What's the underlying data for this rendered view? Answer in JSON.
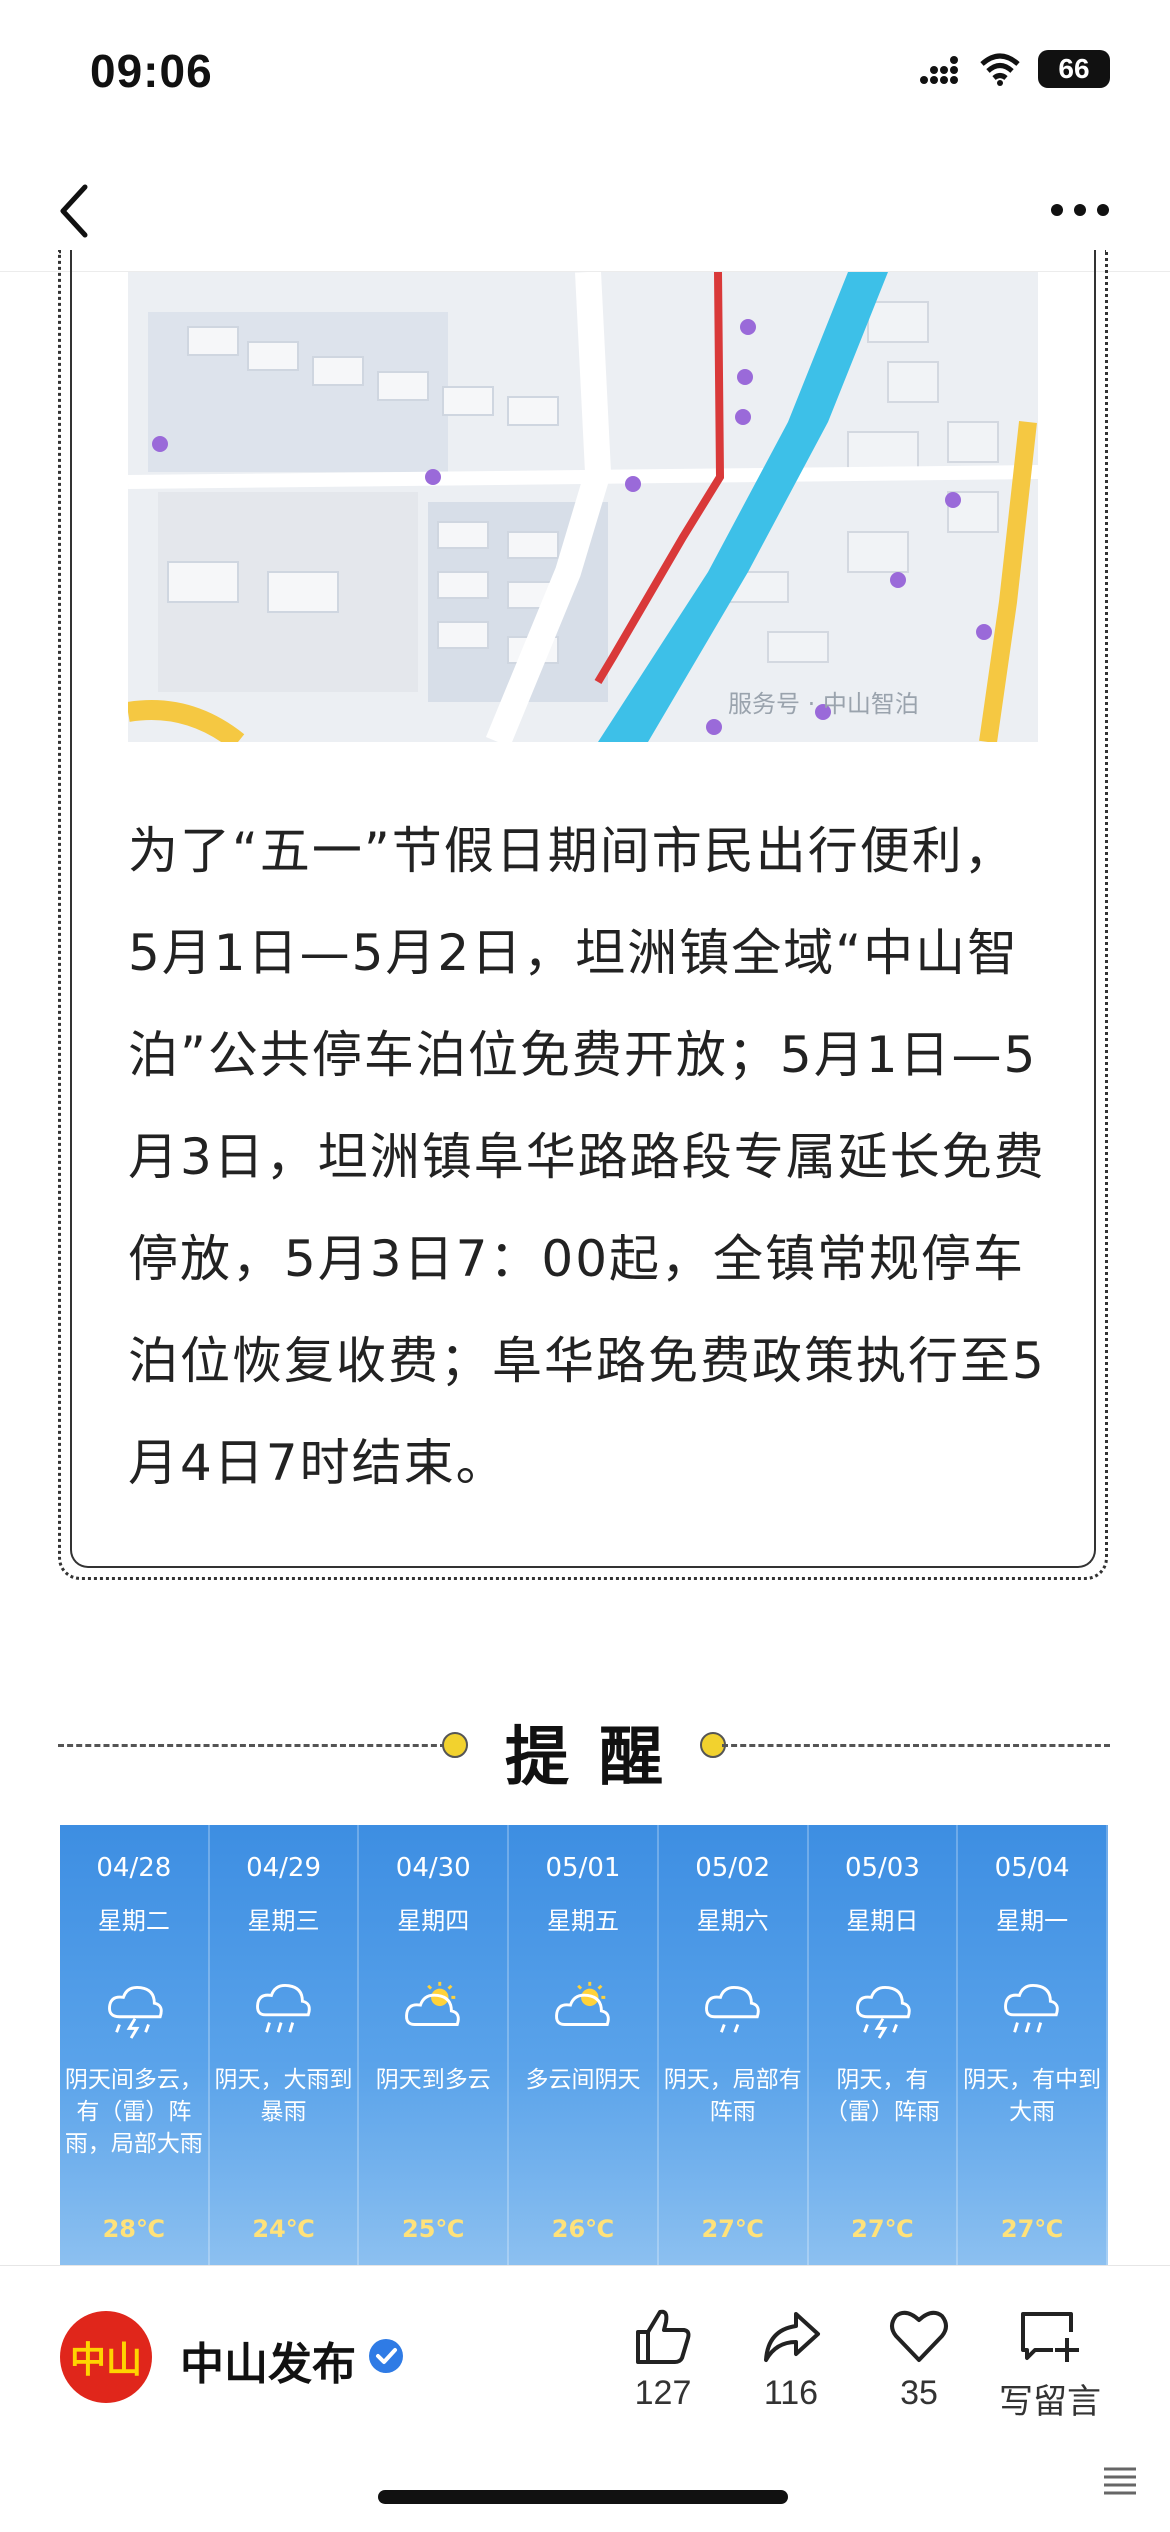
{
  "status_bar": {
    "time": "09:06",
    "battery": "66"
  },
  "map": {
    "watermark": "服务号 · 中山智泊"
  },
  "article": {
    "paragraph": "为了“五一”节假日期间市民出行便利，5月1日—5月2日，坦洲镇全域“中山智泊”公共停车泊位免费开放；5月1日—5月3日，坦洲镇阜华路路段专属延长免费停放，5月3日7：00起，全镇常规停车泊位恢复收费；阜华路免费政策执行至5月4日7时结束。"
  },
  "reminder": {
    "title": "提醒"
  },
  "weather": {
    "days": [
      {
        "date": "04/28",
        "dow": "星期二",
        "icon": "thunder-rain-icon",
        "desc": "阴天间多云，有（雷）阵雨，局部大雨",
        "temp": "28℃"
      },
      {
        "date": "04/29",
        "dow": "星期三",
        "icon": "rain-icon",
        "desc": "阴天，大雨到暴雨",
        "temp": "24℃"
      },
      {
        "date": "04/30",
        "dow": "星期四",
        "icon": "sun-cloud-icon",
        "desc": "阴天到多云",
        "temp": "25℃"
      },
      {
        "date": "05/01",
        "dow": "星期五",
        "icon": "sun-cloud-icon",
        "desc": "多云间阴天",
        "temp": "26℃"
      },
      {
        "date": "05/02",
        "dow": "星期六",
        "icon": "cloud-rain-icon",
        "desc": "阴天，局部有阵雨",
        "temp": "27℃"
      },
      {
        "date": "05/03",
        "dow": "星期日",
        "icon": "thunder-rain-icon",
        "desc": "阴天，有（雷）阵雨",
        "temp": "27℃"
      },
      {
        "date": "05/04",
        "dow": "星期一",
        "icon": "rain-icon",
        "desc": "阴天，有中到大雨",
        "temp": "27℃"
      }
    ]
  },
  "account": {
    "name": "中山发布",
    "logo_text": "中山"
  },
  "actions": {
    "like": "127",
    "share": "116",
    "favorite": "35",
    "comment": "写留言"
  }
}
